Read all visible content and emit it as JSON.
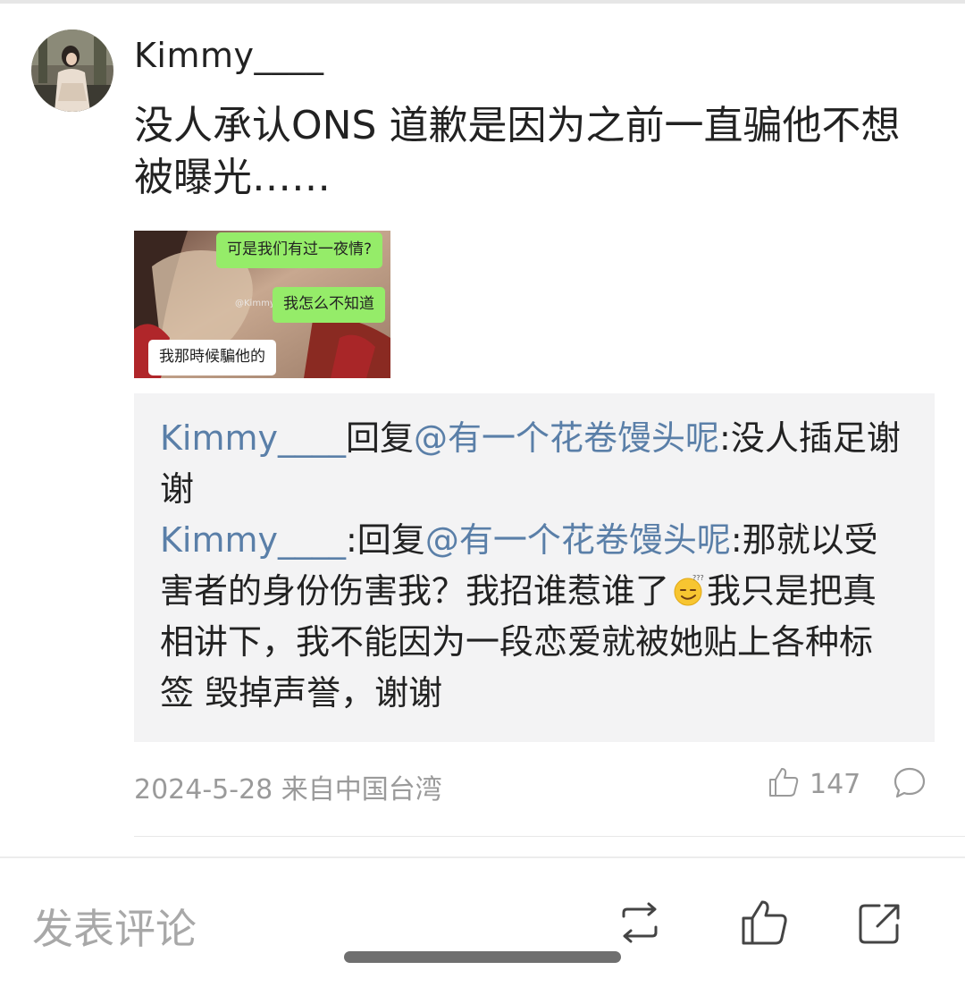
{
  "comment": {
    "username": "Kimmy____",
    "text": "没人承认ONS 道歉是因为之前一直骗他不想被曝光……",
    "image": {
      "bubble_top": "可是我们有过一夜情?",
      "bubble_mid": "我怎么不知道",
      "bubble_bottom": "我那時候騙他的",
      "watermark": "@Kimmy"
    },
    "replies": [
      {
        "author": "Kimmy____",
        "sep": "回复",
        "mention": "@有一个花卷馒头呢",
        "text": ":没人插足谢谢"
      },
      {
        "author": "Kimmy____",
        "sep": ":回复",
        "mention": "@有一个花卷馒头呢",
        "text_before_emoji": ":那就以受害者的身份伤害我？我招谁惹谁了",
        "emoji": "dizzy-face-emoji",
        "text_after_emoji": "我只是把真相讲下，我不能因为一段恋爱就被她贴上各种标签 毁掉声誉，谢谢"
      }
    ],
    "meta": {
      "date_location": "2024-5-28 来自中国台湾",
      "like_count": "147"
    }
  },
  "bottom_bar": {
    "compose_placeholder": "发表评论",
    "icons": [
      "repost-icon",
      "like-icon",
      "share-icon"
    ]
  },
  "colors": {
    "link": "#5a7fa8",
    "meta_gray": "#9a9a9a",
    "reply_bg": "#f3f3f4",
    "wechat_green": "#95ec69"
  }
}
